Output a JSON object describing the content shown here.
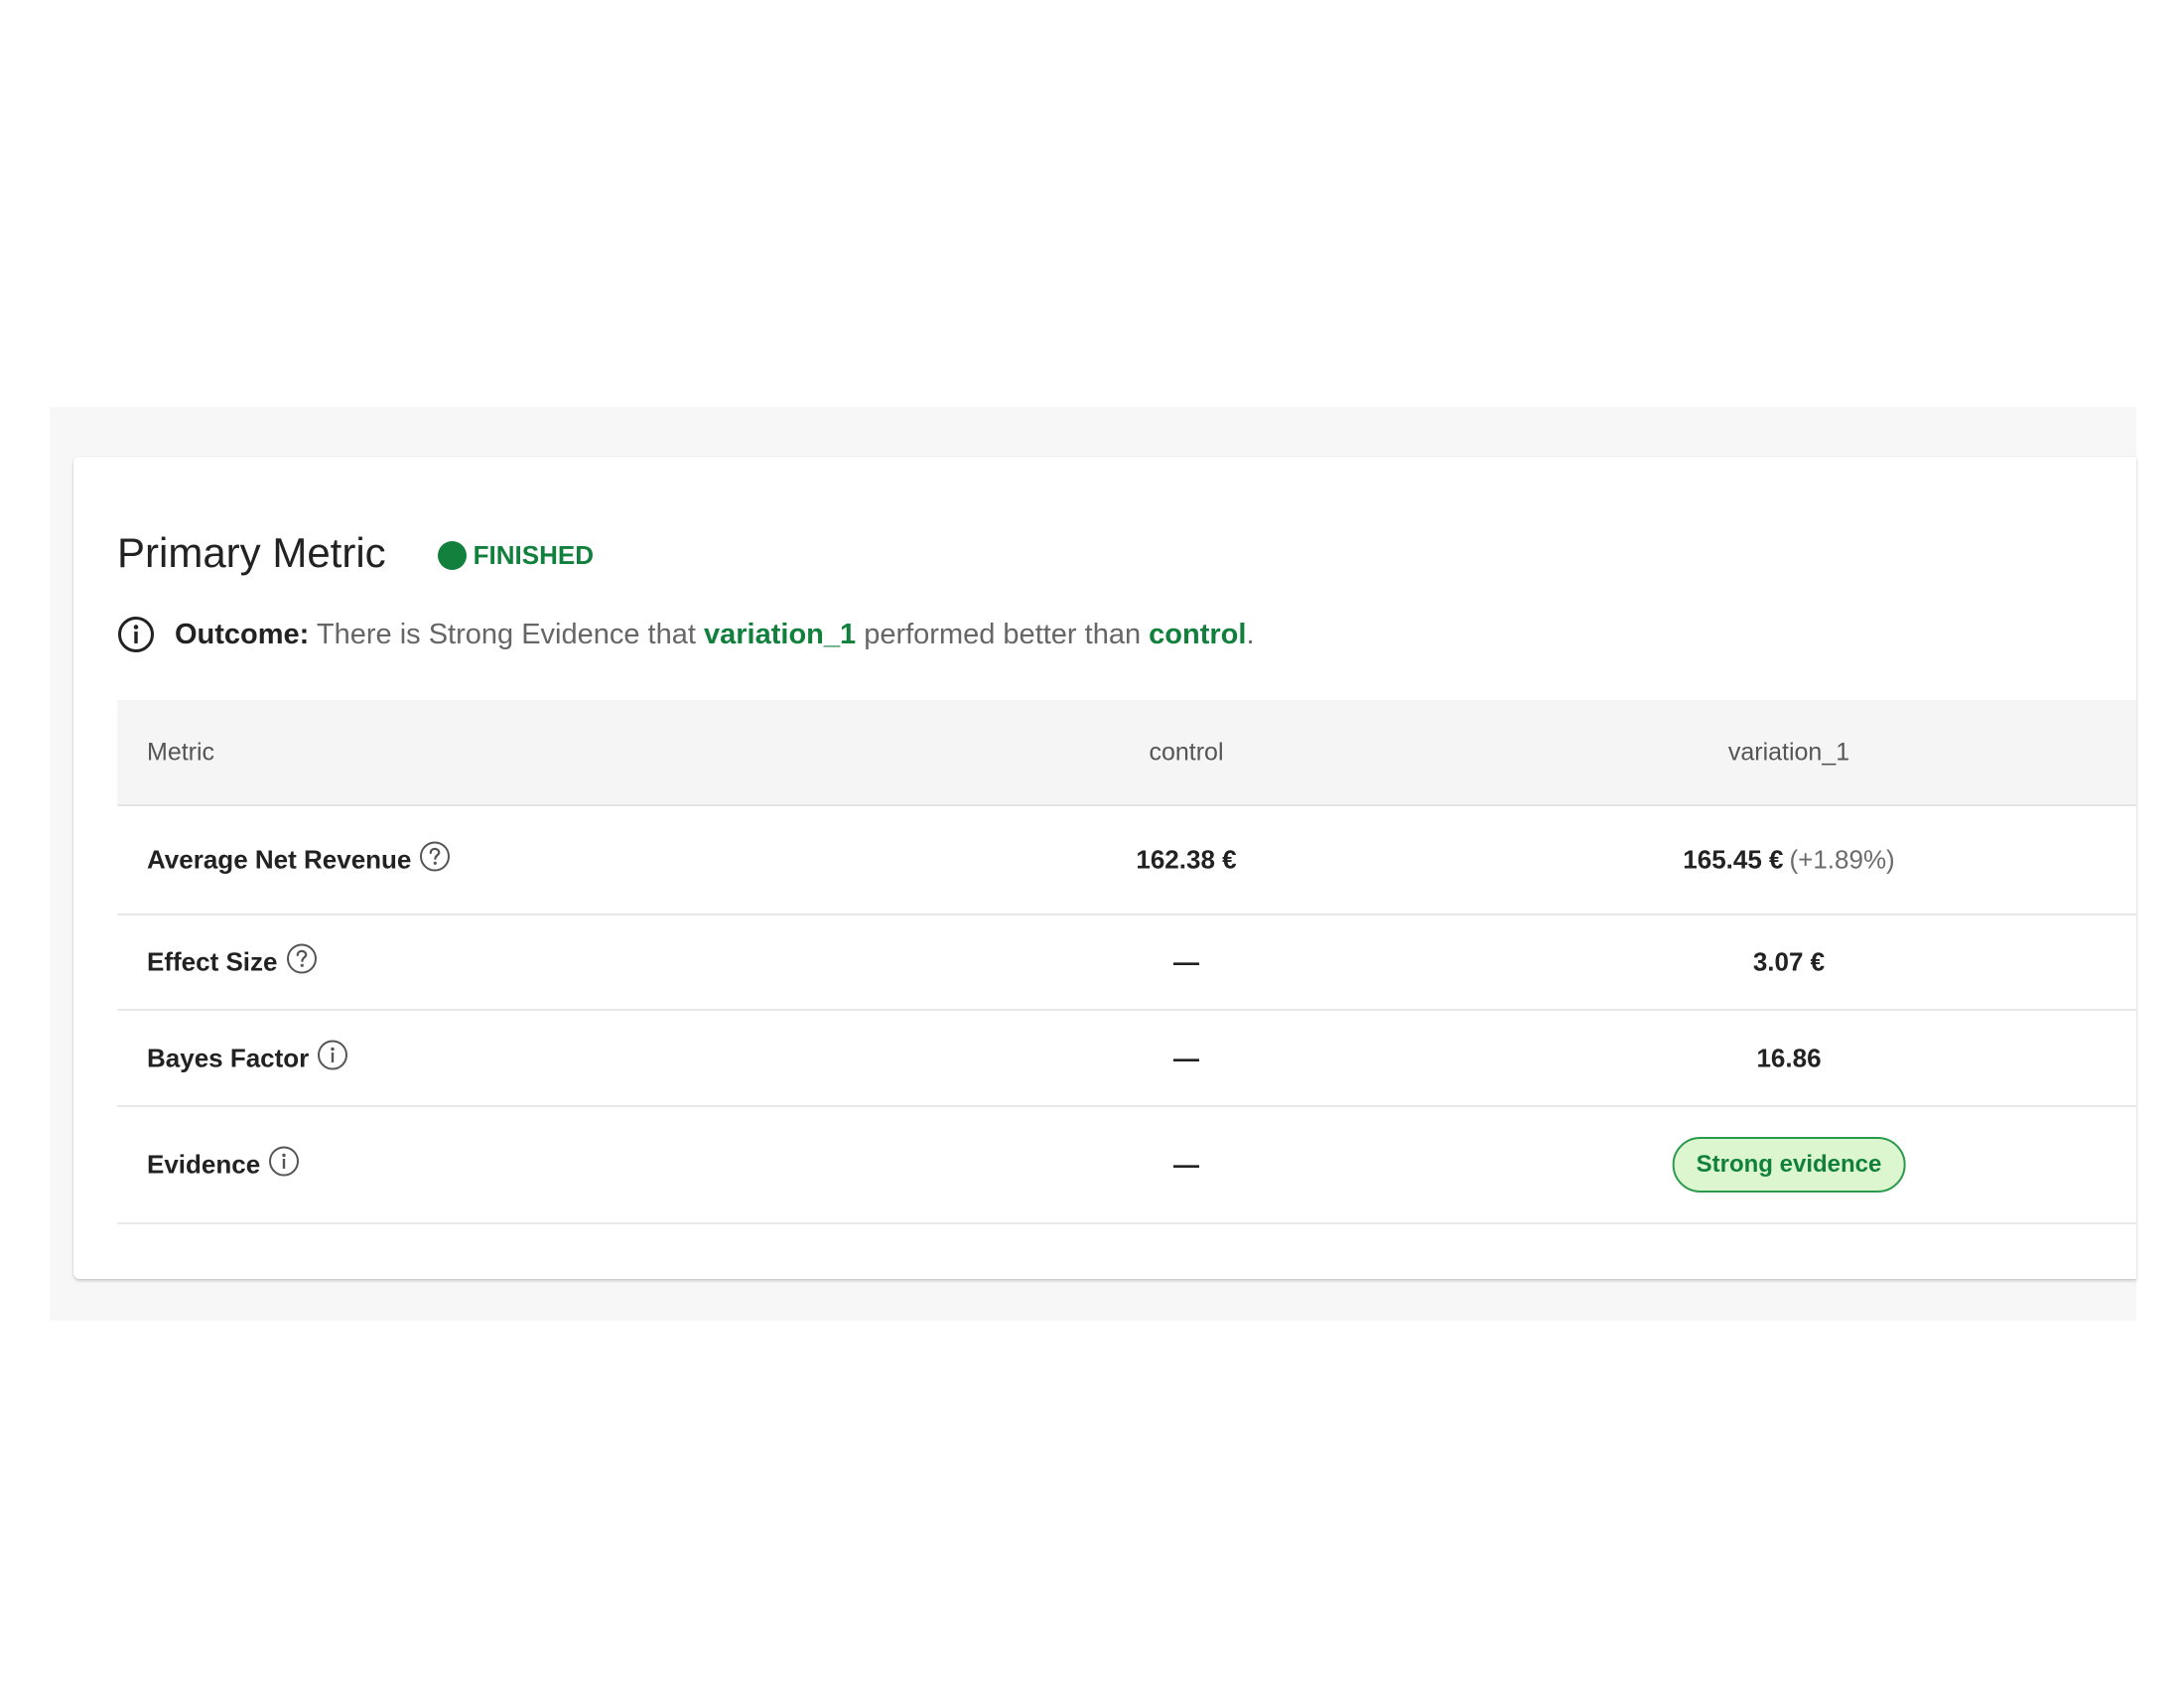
{
  "header": {
    "title": "Primary Metric",
    "status": "FINISHED"
  },
  "outcome": {
    "label": "Outcome:",
    "text_1": "There is Strong Evidence that",
    "variant": "variation_1",
    "text_2": "performed better than",
    "baseline": "control",
    "text_3": "."
  },
  "table": {
    "headers": {
      "metric": "Metric",
      "control": "control",
      "variation": "variation_1"
    },
    "rows": [
      {
        "metric": "Average Net Revenue",
        "icon": "question-circle-icon",
        "control": "162.38 €",
        "variation": "165.45 €",
        "variation_delta": "(+1.89%)"
      },
      {
        "metric": "Effect Size",
        "icon": "question-circle-icon",
        "control": "—",
        "variation": "3.07 €"
      },
      {
        "metric": "Bayes Factor",
        "icon": "info-circle-icon",
        "control": "—",
        "variation": "16.86"
      },
      {
        "metric": "Evidence",
        "icon": "info-circle-icon",
        "control": "—",
        "variation": "Strong evidence"
      }
    ]
  },
  "colors": {
    "accent_green": "#11803d",
    "badge_bg": "#dcf7cf",
    "badge_border": "#2a9b4c",
    "panel_bg": "#f7f7f7"
  }
}
